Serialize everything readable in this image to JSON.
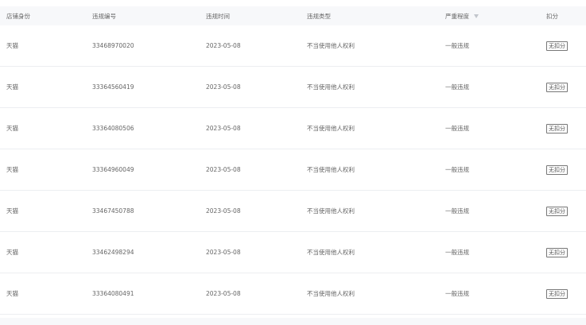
{
  "columns": {
    "shop_identity": "店铺身份",
    "violation_id": "违规编号",
    "violation_time": "违规时间",
    "violation_type": "违规类型",
    "severity": "严重程度",
    "deduction": "扣分"
  },
  "rows": [
    {
      "shop": "天猫",
      "id": "33468970020",
      "time": "2023-05-08",
      "type": "不当使用他人权利",
      "severity": "一般违规",
      "deduction": "无扣分"
    },
    {
      "shop": "天猫",
      "id": "33364560419",
      "time": "2023-05-08",
      "type": "不当使用他人权利",
      "severity": "一般违规",
      "deduction": "无扣分"
    },
    {
      "shop": "天猫",
      "id": "33364080506",
      "time": "2023-05-08",
      "type": "不当使用他人权利",
      "severity": "一般违规",
      "deduction": "无扣分"
    },
    {
      "shop": "天猫",
      "id": "33364960049",
      "time": "2023-05-08",
      "type": "不当使用他人权利",
      "severity": "一般违规",
      "deduction": "无扣分"
    },
    {
      "shop": "天猫",
      "id": "33467450788",
      "time": "2023-05-08",
      "type": "不当使用他人权利",
      "severity": "一般违规",
      "deduction": "无扣分"
    },
    {
      "shop": "天猫",
      "id": "33462498294",
      "time": "2023-05-08",
      "type": "不当使用他人权利",
      "severity": "一般违规",
      "deduction": "无扣分"
    },
    {
      "shop": "天猫",
      "id": "33364080491",
      "time": "2023-05-08",
      "type": "不当使用他人权利",
      "severity": "一般违规",
      "deduction": "无扣分"
    }
  ],
  "colors": {
    "header_bg": "#f7f8fa",
    "row_border": "#eceef1",
    "text": "#666666"
  }
}
